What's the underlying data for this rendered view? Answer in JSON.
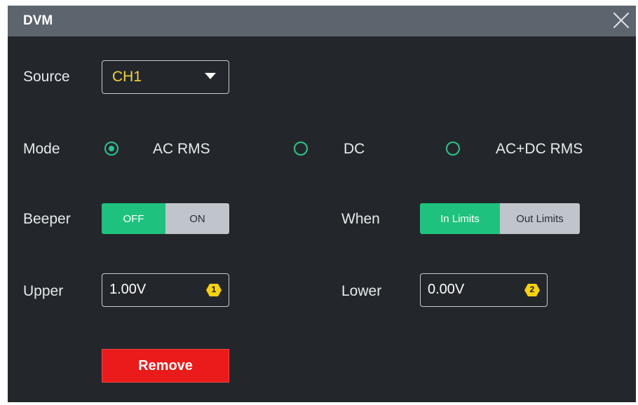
{
  "dialog": {
    "title": "DVM"
  },
  "source": {
    "label": "Source",
    "value": "CH1"
  },
  "mode": {
    "label": "Mode",
    "options": [
      {
        "label": "AC RMS",
        "selected": true
      },
      {
        "label": "DC",
        "selected": false
      },
      {
        "label": "AC+DC RMS",
        "selected": false
      }
    ]
  },
  "beeper": {
    "label": "Beeper",
    "off_label": "OFF",
    "on_label": "ON",
    "active": "OFF"
  },
  "when": {
    "label": "When",
    "in_label": "In Limits",
    "out_label": "Out Limits",
    "active": "In Limits"
  },
  "upper": {
    "label": "Upper",
    "value": "1.00V",
    "knob": "1"
  },
  "lower": {
    "label": "Lower",
    "value": "0.00V",
    "knob": "2"
  },
  "remove_label": "Remove",
  "colors": {
    "accent": "#1ec27e",
    "remove": "#ea1b1b",
    "source_value": "#f2d23d",
    "knob": "#f5d20e"
  },
  "icons": {
    "close": "close-icon",
    "dropdown": "caret-down-icon",
    "knob_badge": "hexagon-badge-icon"
  }
}
